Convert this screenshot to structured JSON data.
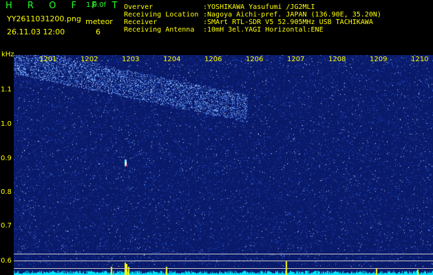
{
  "header": {
    "brand": "H R O F F T",
    "version": "1.0.0f",
    "filename": "YY2611031200.png",
    "datetime": "26.11.03 12:00",
    "meteor_label": "meteor",
    "meteor_count": "6",
    "info": [
      {
        "key": "Overver",
        "value": ":YOSHIKAWA Yasufumi /JG2MLI"
      },
      {
        "key": "Receiving Location",
        "value": ":Nagoya Aichi-pref. JAPAN (136.90E, 35.20N)"
      },
      {
        "key": "Receiver",
        "value": ":SMArt RTL-SDR V5 52.905MHz USB TACHIKAWA"
      },
      {
        "key": "Receiving Antenna",
        "value": ":10mH 3el.YAGI Horizontal:ENE"
      }
    ]
  },
  "spectrogram": {
    "y_unit": "kHz",
    "y_ticks": [
      "1.1",
      "1.0",
      "0.9",
      "0.8",
      "0.7",
      "0.6"
    ],
    "x_ticks": [
      "1201",
      "1202",
      "1203",
      "1204",
      "1206",
      "1206",
      "1207",
      "1208",
      "1209",
      "1210"
    ],
    "colors": {
      "background": "#0a1a6a",
      "label": "#ffff00",
      "spectrum": "#00e5ff",
      "peak": "#ffff00"
    }
  }
}
